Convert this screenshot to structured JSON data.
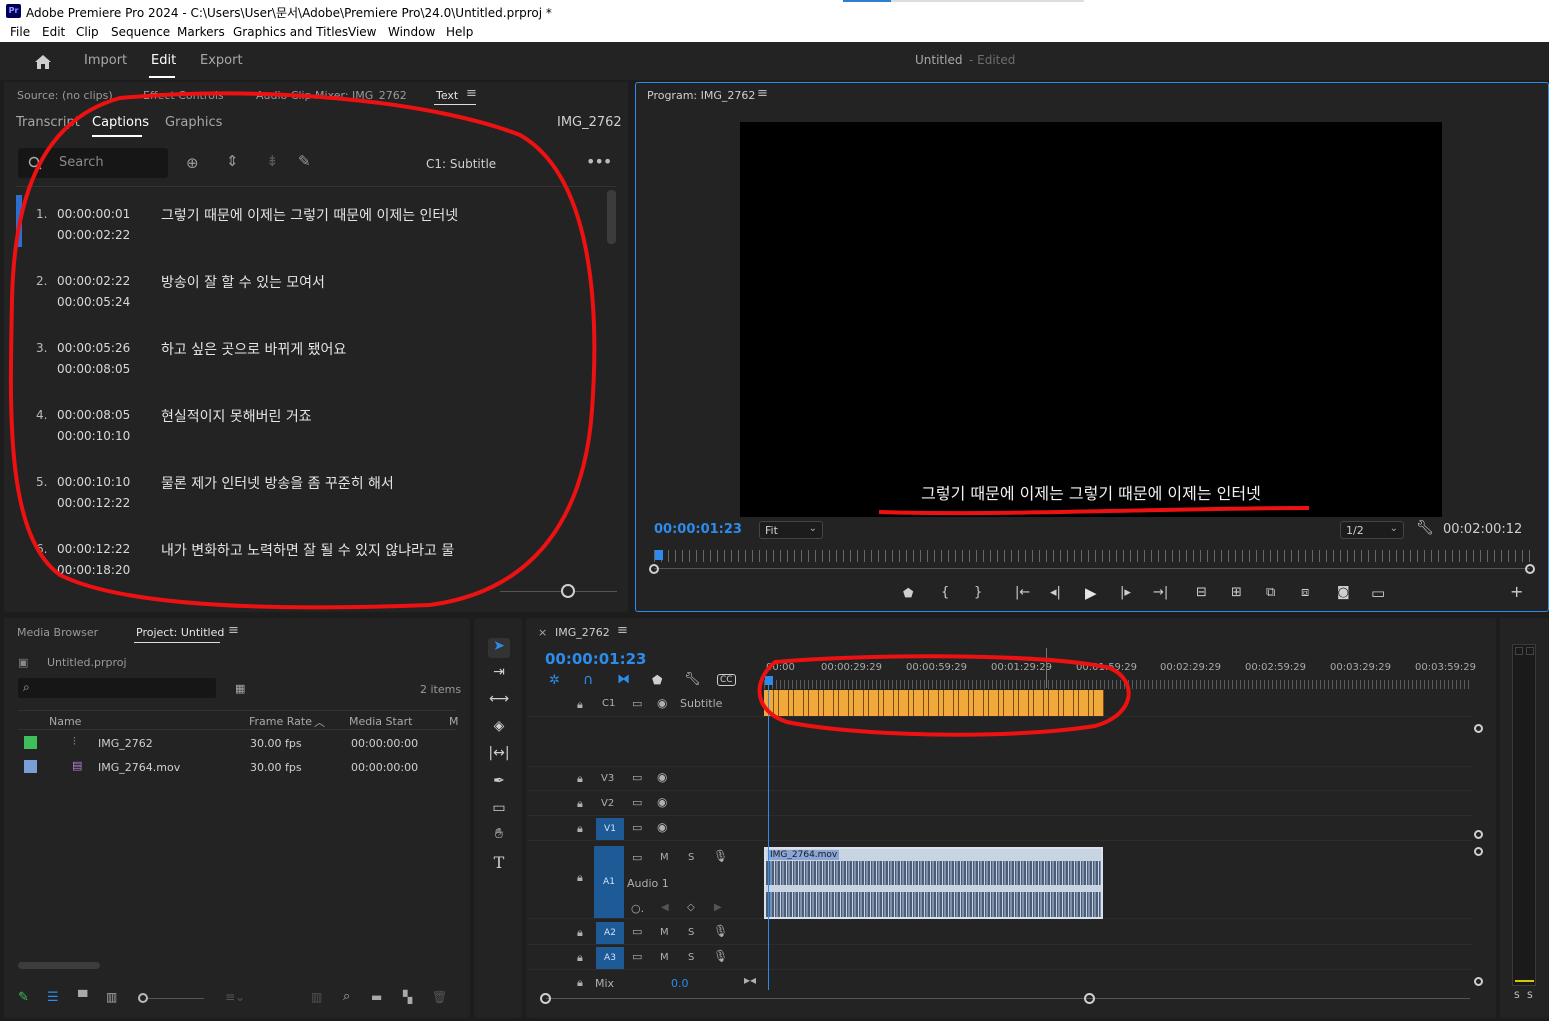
{
  "window": {
    "title": "Adobe Premiere Pro 2024 - C:\\Users\\User\\문서\\Adobe\\Premiere Pro\\24.0\\Untitled.prproj *",
    "app_icon": "Pr"
  },
  "menu": [
    "File",
    "Edit",
    "Clip",
    "Sequence",
    "Markers",
    "Graphics and Titles",
    "View",
    "Window",
    "Help"
  ],
  "workspace": {
    "tabs": [
      "Import",
      "Edit",
      "Export"
    ],
    "active": "Edit",
    "project_name": "Untitled",
    "project_status": "- Edited"
  },
  "source_panel": {
    "tabs": [
      "Source: (no clips)",
      "Effect Controls",
      "Audio Clip Mixer: IMG_2762",
      "Text"
    ],
    "subtabs": [
      "Transcript",
      "Captions",
      "Graphics"
    ],
    "active_subtab": "Captions",
    "sequence_name": "IMG_2762",
    "search_placeholder": "Search",
    "track_label": "C1: Subtitle",
    "captions": [
      {
        "num": "1.",
        "in": "00:00:00:01",
        "out": "00:00:02:22",
        "text": "그렇기 때문에 이제는 그렇기 때문에 이제는 인터넷"
      },
      {
        "num": "2.",
        "in": "00:00:02:22",
        "out": "00:00:05:24",
        "text": "방송이 잘 할 수 있는 모여서"
      },
      {
        "num": "3.",
        "in": "00:00:05:26",
        "out": "00:00:08:05",
        "text": "하고 싶은 곳으로 바뀌게 됐어요"
      },
      {
        "num": "4.",
        "in": "00:00:08:05",
        "out": "00:00:10:10",
        "text": "현실적이지 못해버린 거죠"
      },
      {
        "num": "5.",
        "in": "00:00:10:10",
        "out": "00:00:12:22",
        "text": "물론 제가 인터넷 방송을 좀 꾸준히 해서"
      },
      {
        "num": "6.",
        "in": "00:00:12:22",
        "out": "00:00:18:20",
        "text": "내가 변화하고 노력하면 잘 될 수 있지 않냐라고 물"
      }
    ]
  },
  "program_monitor": {
    "title": "Program: IMG_2762",
    "subtitle_overlay": "그렇기 때문에 이제는 그렇기 때문에 이제는 인터넷",
    "current_time": "00:00:01:23",
    "fit": "Fit",
    "resolution": "1/2",
    "duration": "00:02:00:12"
  },
  "project_panel": {
    "tabs": [
      "Media Browser",
      "Project: Untitled"
    ],
    "file": "Untitled.prproj",
    "items_count": "2 items",
    "columns": [
      "Name",
      "Frame Rate",
      "Media Start",
      "M"
    ],
    "rows": [
      {
        "color": "#3fbf5a",
        "name": "IMG_2762",
        "frame_rate": "30.00 fps",
        "media_start": "00:00:00:00"
      },
      {
        "color": "#7a9fd6",
        "name": "IMG_2764.mov",
        "frame_rate": "30.00 fps",
        "media_start": "00:00:00:00"
      }
    ]
  },
  "timeline": {
    "sequence": "IMG_2762",
    "current_time": "00:00:01:23",
    "ruler": [
      "00:00",
      "00:00:29:29",
      "00:00:59:29",
      "00:01:29:29",
      "00:01:59:29",
      "00:02:29:29",
      "00:02:59:29",
      "00:03:29:29",
      "00:03:59:29"
    ],
    "caption_track": {
      "id": "C1",
      "name": "Subtitle"
    },
    "video_tracks": [
      "V3",
      "V2",
      "V1"
    ],
    "audio_tracks": [
      "A1",
      "A2",
      "A3"
    ],
    "audio_track_name": "Audio 1",
    "clip_name": "IMG_2764.mov",
    "mix_label": "Mix",
    "mix_value": "0.0",
    "track_buttons": {
      "mute": "M",
      "solo": "S"
    }
  },
  "meter": {
    "labels": [
      "S",
      "S"
    ]
  },
  "colors": {
    "accent_blue": "#2d8ceb",
    "caption_clip": "#f0a93a",
    "annotation_red": "#e11111"
  }
}
